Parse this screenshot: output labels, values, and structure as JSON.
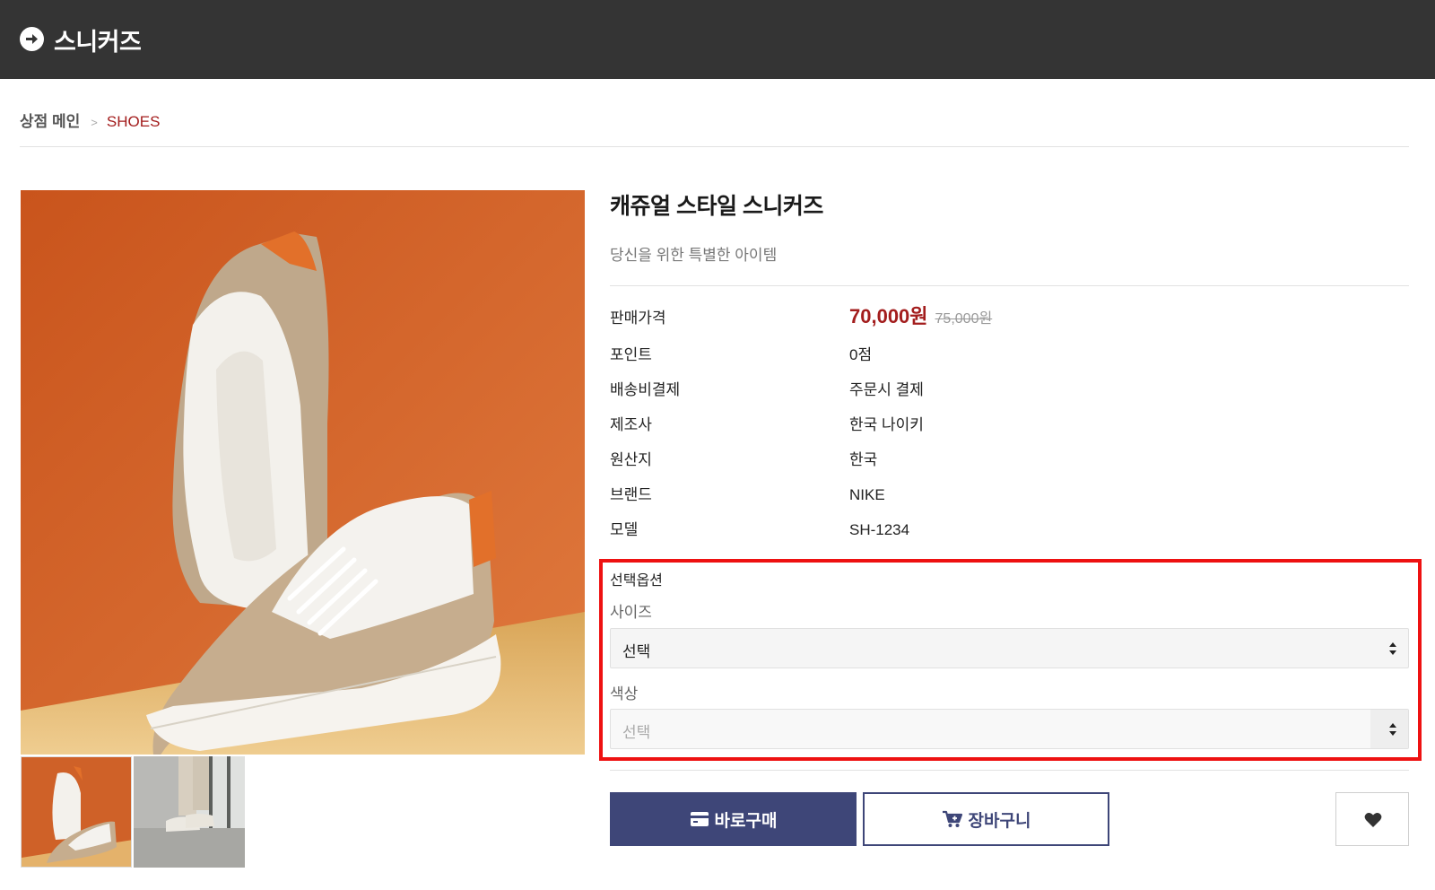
{
  "header": {
    "title": "스니커즈",
    "back_icon": "circle-arrow-right-icon"
  },
  "breadcrumb": {
    "home": "상점 메인",
    "separator": ">",
    "current": "SHOES"
  },
  "product": {
    "name": "캐쥬얼 스타일 스니커즈",
    "subtitle": "당신을 위한 특별한 아이템",
    "info": [
      {
        "label": "판매가격",
        "price": "70,000원",
        "original_price": "75,000원"
      },
      {
        "label": "포인트",
        "value": "0점"
      },
      {
        "label": "배송비결제",
        "value": "주문시 결제"
      },
      {
        "label": "제조사",
        "value": "한국 나이키"
      },
      {
        "label": "원산지",
        "value": "한국"
      },
      {
        "label": "브랜드",
        "value": "NIKE"
      },
      {
        "label": "모델",
        "value": "SH-1234"
      }
    ]
  },
  "options": {
    "title": "선택옵션",
    "size": {
      "label": "사이즈",
      "selected": "선택"
    },
    "color": {
      "label": "색상",
      "selected": "선택"
    }
  },
  "actions": {
    "buy_label": "바로구매",
    "cart_label": "장바구니",
    "buy_icon": "credit-card-icon",
    "cart_icon": "cart-plus-icon",
    "wish_icon": "heart-icon"
  },
  "colors": {
    "header_bg": "#343434",
    "accent_red": "#a31d1d",
    "button_navy": "#3e4678",
    "highlight_border": "#ee1111"
  }
}
